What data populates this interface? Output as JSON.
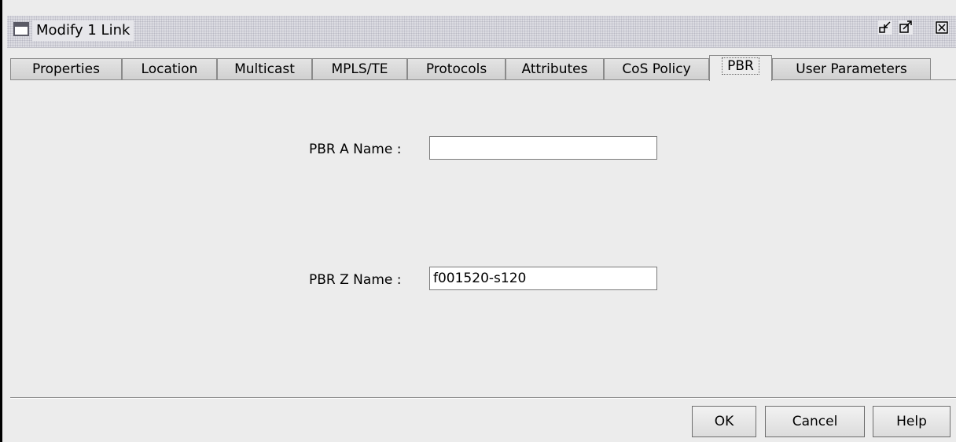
{
  "window": {
    "title": "Modify 1 Link",
    "controls": {
      "minimize_icon": "undock-icon",
      "maximize_icon": "maximize-icon",
      "close_icon": "close-icon"
    }
  },
  "tabs": [
    {
      "label": "Properties"
    },
    {
      "label": "Location"
    },
    {
      "label": "Multicast"
    },
    {
      "label": "MPLS/TE"
    },
    {
      "label": "Protocols"
    },
    {
      "label": "Attributes"
    },
    {
      "label": "CoS Policy"
    },
    {
      "label": "PBR",
      "active": true
    },
    {
      "label": "User Parameters"
    }
  ],
  "form": {
    "pbr_a": {
      "label": "PBR A Name :",
      "value": ""
    },
    "pbr_z": {
      "label": "PBR Z Name :",
      "value": "f001520-s120"
    }
  },
  "buttons": {
    "ok": "OK",
    "cancel": "Cancel",
    "help": "Help"
  }
}
